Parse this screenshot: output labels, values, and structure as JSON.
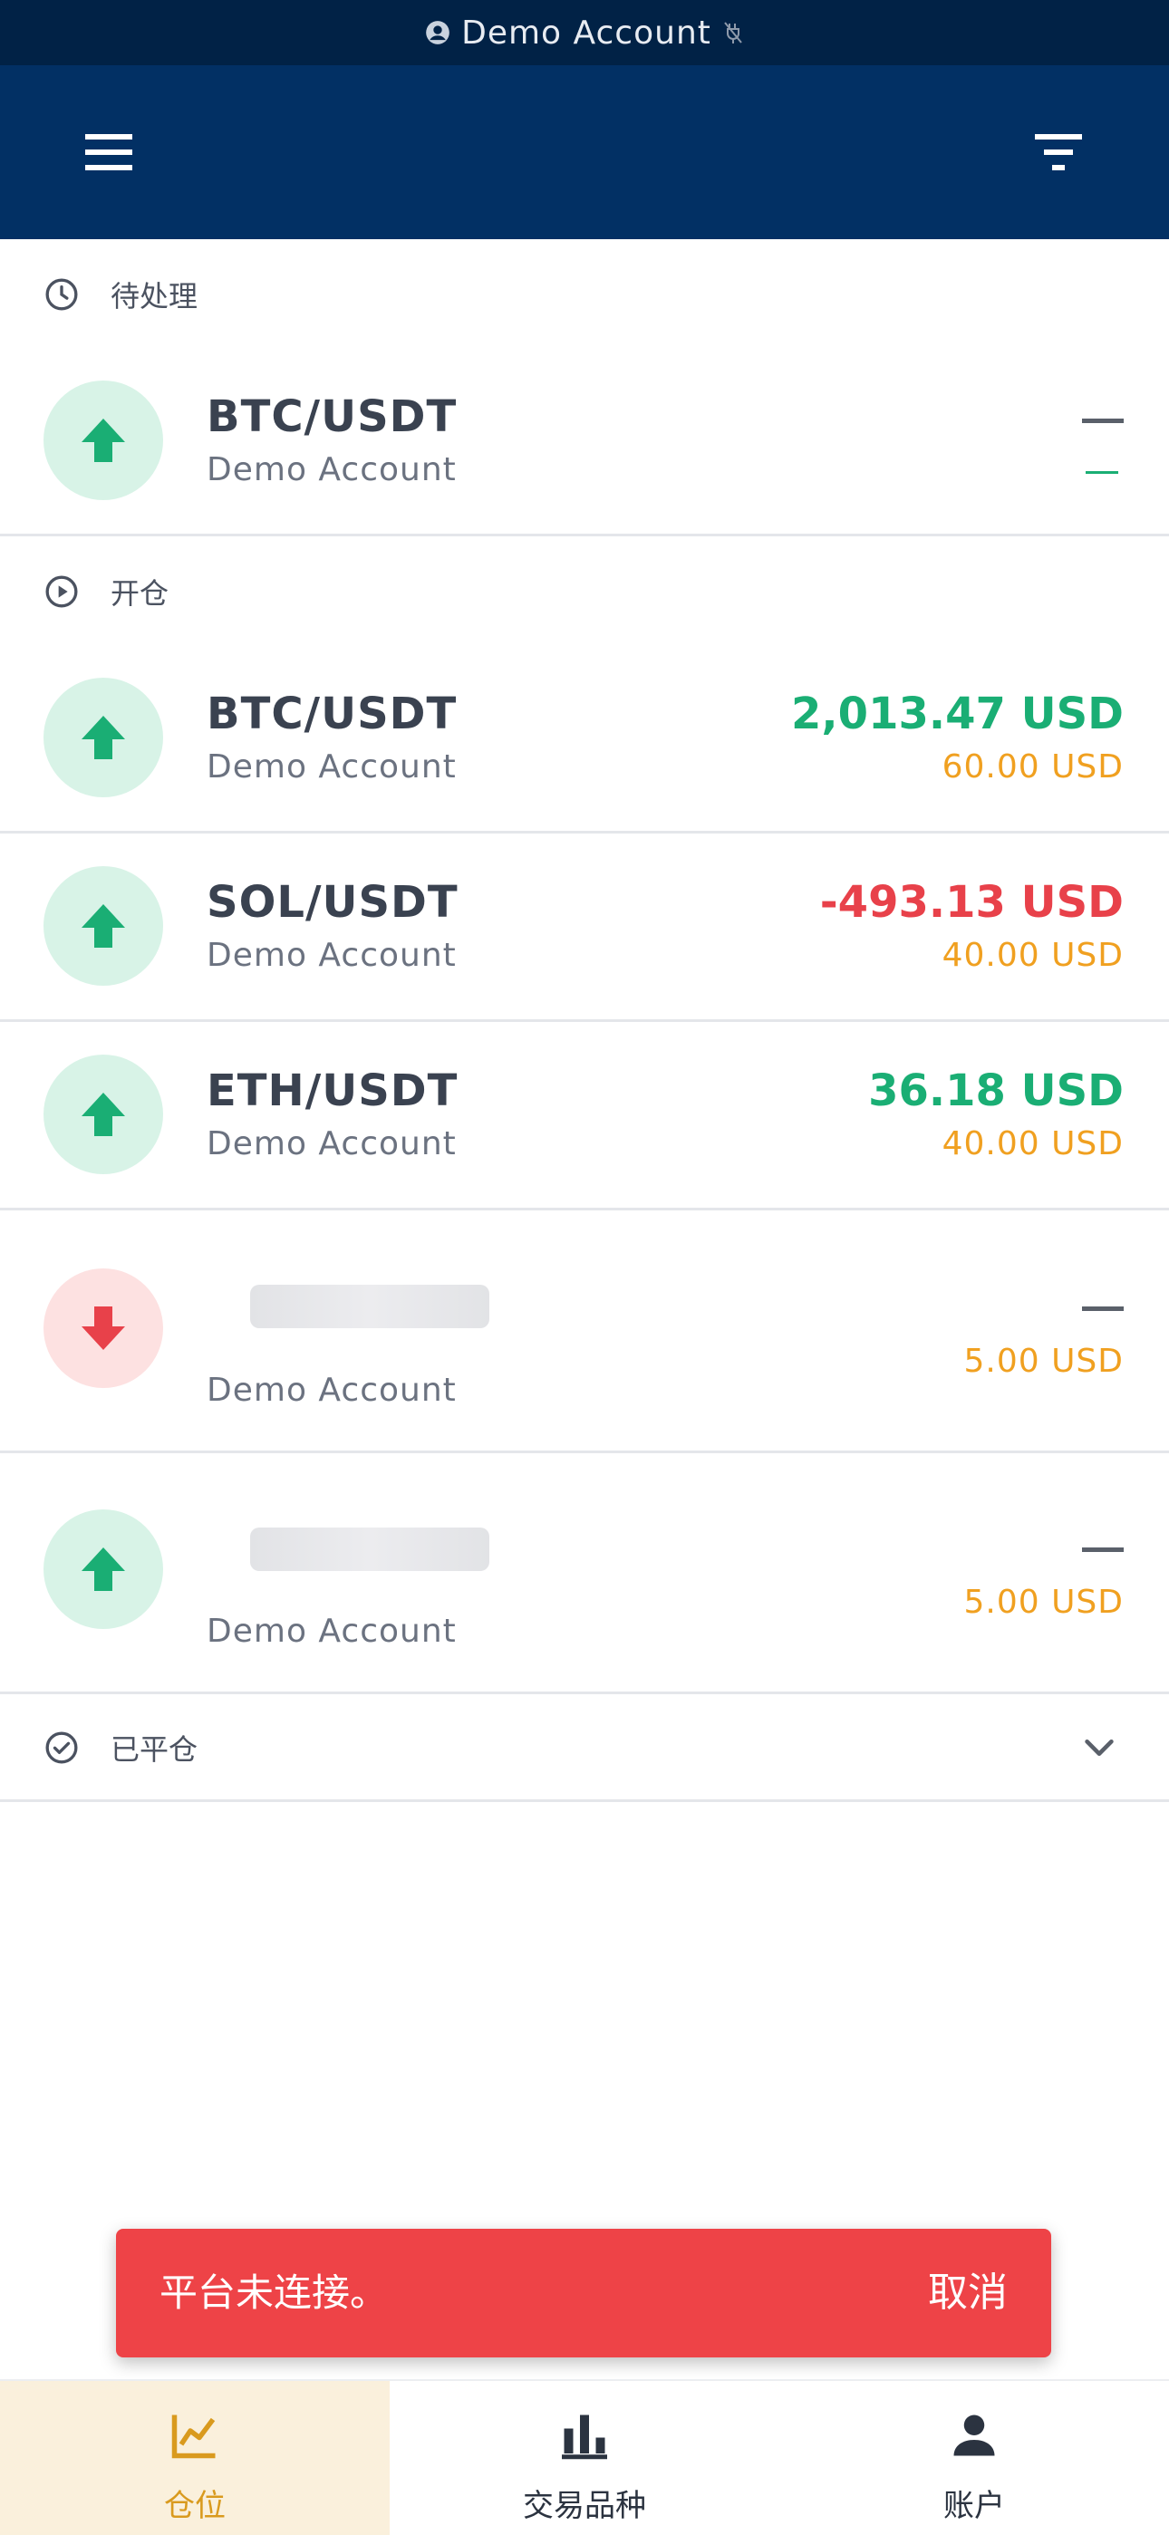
{
  "status_bar": {
    "account_label": "Demo Account"
  },
  "sections": {
    "pending": "待处理",
    "open": "开仓",
    "closed": "已平仓"
  },
  "pending_positions": [
    {
      "pair": "BTC/USDT",
      "account": "Demo Account",
      "direction": "up"
    }
  ],
  "open_positions": [
    {
      "pair": "BTC/USDT",
      "account": "Demo Account",
      "direction": "up",
      "pnl": "2,013.47 USD",
      "pnl_status": "positive",
      "amount": "60.00 USD"
    },
    {
      "pair": "SOL/USDT",
      "account": "Demo Account",
      "direction": "up",
      "pnl": "-493.13 USD",
      "pnl_status": "negative",
      "amount": "40.00 USD"
    },
    {
      "pair": "ETH/USDT",
      "account": "Demo Account",
      "direction": "up",
      "pnl": "36.18 USD",
      "pnl_status": "positive",
      "amount": "40.00 USD"
    },
    {
      "pair": "",
      "account": "Demo Account",
      "direction": "down",
      "pnl": "",
      "amount": "5.00 USD"
    },
    {
      "pair": "",
      "account": "Demo Account",
      "direction": "up",
      "pnl": "",
      "amount": "5.00 USD"
    }
  ],
  "snackbar": {
    "message": "平台未连接。",
    "action": "取消"
  },
  "bottom_nav": [
    {
      "label": "仓位",
      "icon": "line-chart-icon",
      "active": true
    },
    {
      "label": "交易品种",
      "icon": "bar-chart-icon",
      "active": false
    },
    {
      "label": "账户",
      "icon": "person-icon",
      "active": false
    }
  ],
  "colors": {
    "header_bg": "#023064",
    "status_bg": "#012246",
    "profit": "#1aae74",
    "loss": "#e8414a",
    "amount": "#f0a020",
    "active_tab": "#d99a1e",
    "snackbar": "#ee4347"
  }
}
